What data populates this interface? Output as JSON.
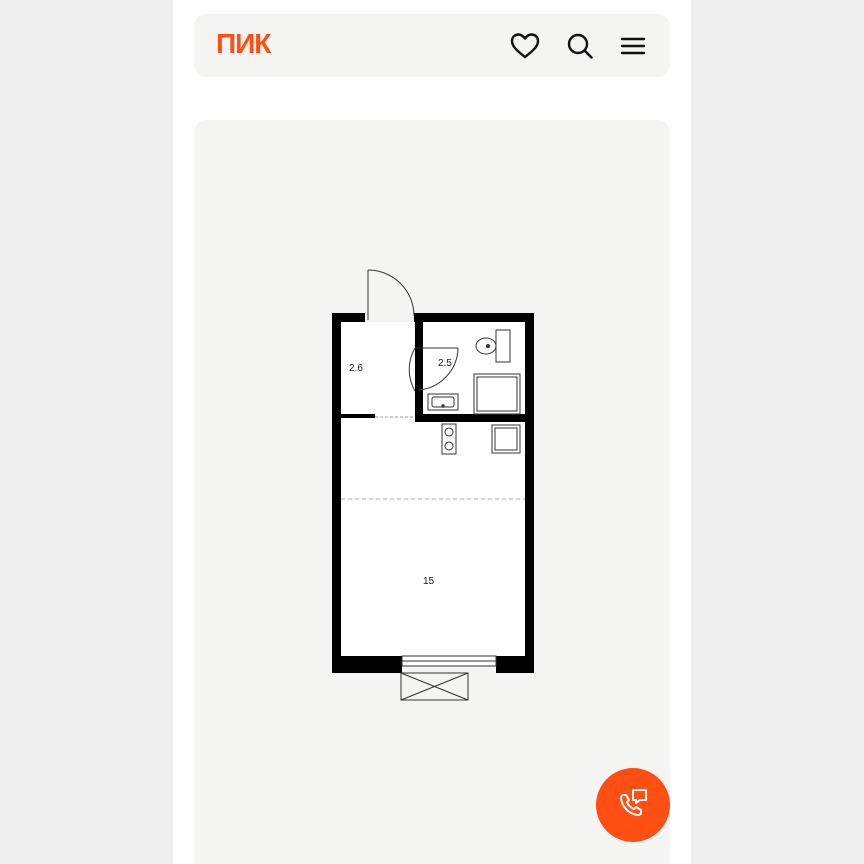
{
  "header": {
    "logo_text": "ПИК",
    "icons": [
      "heart-icon",
      "search-icon",
      "menu-icon"
    ]
  },
  "floorplan": {
    "rooms": [
      {
        "name": "hall",
        "area": "2.6"
      },
      {
        "name": "bathroom",
        "area": "2.5"
      },
      {
        "name": "living-room",
        "area": "15"
      }
    ]
  },
  "call_button": {
    "icon": "phone-chat-icon"
  },
  "colors": {
    "brand": "#ff4f12",
    "page_bg": "#ffffff",
    "card_bg": "#f4f4f3",
    "outer_bg": "#eeeeee",
    "wall": "#000000"
  }
}
